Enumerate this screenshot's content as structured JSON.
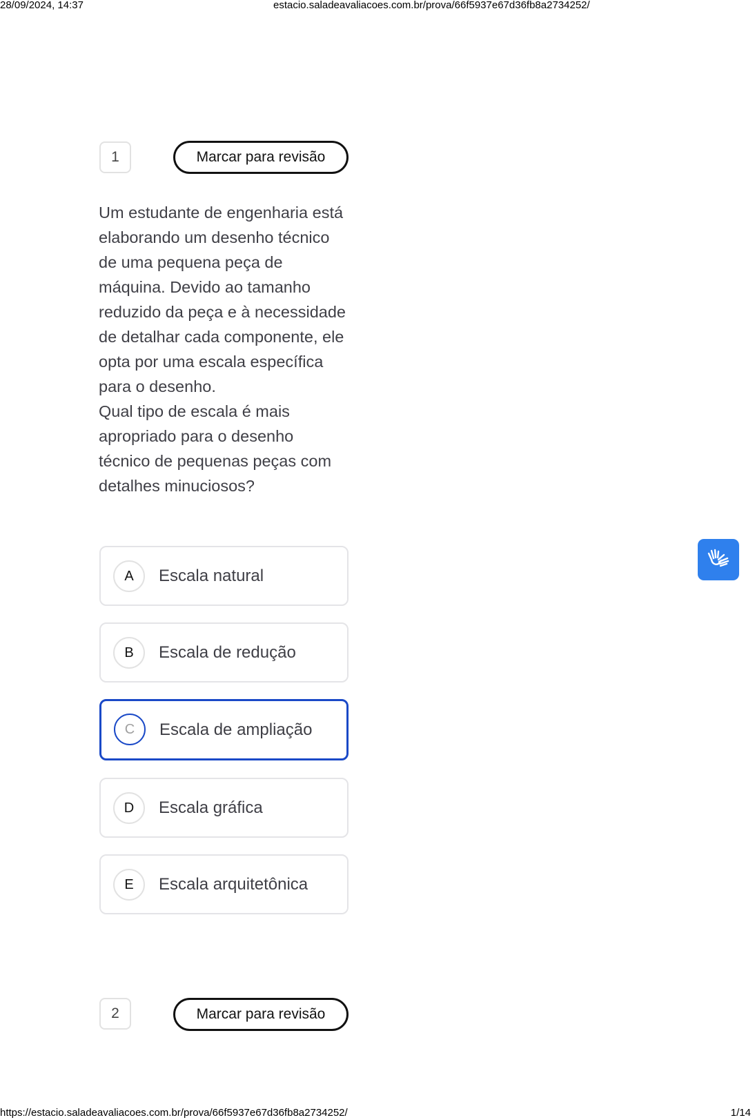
{
  "print_header": {
    "datetime": "28/09/2024, 14:37",
    "url": "estacio.saladeavaliacoes.com.br/prova/66f5937e67d36fb8a2734252/"
  },
  "print_footer": {
    "url": "https://estacio.saladeavaliacoes.com.br/prova/66f5937e67d36fb8a2734252/",
    "page": "1/14"
  },
  "questions": [
    {
      "number": "1",
      "mark_label": "Marcar para revisão",
      "paragraphs": [
        "Um estudante de engenharia está elaborando um desenho técnico de uma pequena peça de máquina. Devido ao tamanho reduzido da peça e à necessidade de detalhar cada componente, ele opta por uma escala específica para o desenho.",
        "Qual tipo de escala é mais apropriado para o desenho técnico de pequenas peças com detalhes minuciosos?"
      ],
      "options": [
        {
          "letter": "A",
          "text": "Escala natural"
        },
        {
          "letter": "B",
          "text": "Escala de redução"
        },
        {
          "letter": "C",
          "text": "Escala de ampliação"
        },
        {
          "letter": "D",
          "text": "Escala gráfica"
        },
        {
          "letter": "E",
          "text": "Escala arquitetônica"
        }
      ],
      "selected": "C"
    },
    {
      "number": "2",
      "mark_label": "Marcar para revisão"
    }
  ],
  "accessibility_button": {
    "icon": "sign-language-hands-icon",
    "color": "#2f80ed"
  },
  "colors": {
    "selected_border": "#1a49c7",
    "text": "#3f3f46"
  }
}
